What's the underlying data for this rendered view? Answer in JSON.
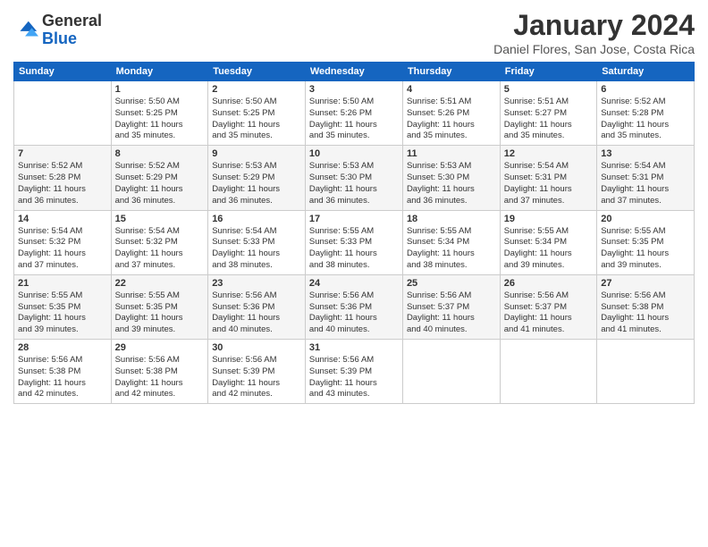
{
  "header": {
    "logo_line1": "General",
    "logo_line2": "Blue",
    "month_title": "January 2024",
    "subtitle": "Daniel Flores, San Jose, Costa Rica"
  },
  "days_of_week": [
    "Sunday",
    "Monday",
    "Tuesday",
    "Wednesday",
    "Thursday",
    "Friday",
    "Saturday"
  ],
  "weeks": [
    [
      {
        "day": "",
        "info": ""
      },
      {
        "day": "1",
        "info": "Sunrise: 5:50 AM\nSunset: 5:25 PM\nDaylight: 11 hours\nand 35 minutes."
      },
      {
        "day": "2",
        "info": "Sunrise: 5:50 AM\nSunset: 5:25 PM\nDaylight: 11 hours\nand 35 minutes."
      },
      {
        "day": "3",
        "info": "Sunrise: 5:50 AM\nSunset: 5:26 PM\nDaylight: 11 hours\nand 35 minutes."
      },
      {
        "day": "4",
        "info": "Sunrise: 5:51 AM\nSunset: 5:26 PM\nDaylight: 11 hours\nand 35 minutes."
      },
      {
        "day": "5",
        "info": "Sunrise: 5:51 AM\nSunset: 5:27 PM\nDaylight: 11 hours\nand 35 minutes."
      },
      {
        "day": "6",
        "info": "Sunrise: 5:52 AM\nSunset: 5:28 PM\nDaylight: 11 hours\nand 35 minutes."
      }
    ],
    [
      {
        "day": "7",
        "info": "Sunrise: 5:52 AM\nSunset: 5:28 PM\nDaylight: 11 hours\nand 36 minutes."
      },
      {
        "day": "8",
        "info": "Sunrise: 5:52 AM\nSunset: 5:29 PM\nDaylight: 11 hours\nand 36 minutes."
      },
      {
        "day": "9",
        "info": "Sunrise: 5:53 AM\nSunset: 5:29 PM\nDaylight: 11 hours\nand 36 minutes."
      },
      {
        "day": "10",
        "info": "Sunrise: 5:53 AM\nSunset: 5:30 PM\nDaylight: 11 hours\nand 36 minutes."
      },
      {
        "day": "11",
        "info": "Sunrise: 5:53 AM\nSunset: 5:30 PM\nDaylight: 11 hours\nand 36 minutes."
      },
      {
        "day": "12",
        "info": "Sunrise: 5:54 AM\nSunset: 5:31 PM\nDaylight: 11 hours\nand 37 minutes."
      },
      {
        "day": "13",
        "info": "Sunrise: 5:54 AM\nSunset: 5:31 PM\nDaylight: 11 hours\nand 37 minutes."
      }
    ],
    [
      {
        "day": "14",
        "info": "Sunrise: 5:54 AM\nSunset: 5:32 PM\nDaylight: 11 hours\nand 37 minutes."
      },
      {
        "day": "15",
        "info": "Sunrise: 5:54 AM\nSunset: 5:32 PM\nDaylight: 11 hours\nand 37 minutes."
      },
      {
        "day": "16",
        "info": "Sunrise: 5:54 AM\nSunset: 5:33 PM\nDaylight: 11 hours\nand 38 minutes."
      },
      {
        "day": "17",
        "info": "Sunrise: 5:55 AM\nSunset: 5:33 PM\nDaylight: 11 hours\nand 38 minutes."
      },
      {
        "day": "18",
        "info": "Sunrise: 5:55 AM\nSunset: 5:34 PM\nDaylight: 11 hours\nand 38 minutes."
      },
      {
        "day": "19",
        "info": "Sunrise: 5:55 AM\nSunset: 5:34 PM\nDaylight: 11 hours\nand 39 minutes."
      },
      {
        "day": "20",
        "info": "Sunrise: 5:55 AM\nSunset: 5:35 PM\nDaylight: 11 hours\nand 39 minutes."
      }
    ],
    [
      {
        "day": "21",
        "info": "Sunrise: 5:55 AM\nSunset: 5:35 PM\nDaylight: 11 hours\nand 39 minutes."
      },
      {
        "day": "22",
        "info": "Sunrise: 5:55 AM\nSunset: 5:35 PM\nDaylight: 11 hours\nand 39 minutes."
      },
      {
        "day": "23",
        "info": "Sunrise: 5:56 AM\nSunset: 5:36 PM\nDaylight: 11 hours\nand 40 minutes."
      },
      {
        "day": "24",
        "info": "Sunrise: 5:56 AM\nSunset: 5:36 PM\nDaylight: 11 hours\nand 40 minutes."
      },
      {
        "day": "25",
        "info": "Sunrise: 5:56 AM\nSunset: 5:37 PM\nDaylight: 11 hours\nand 40 minutes."
      },
      {
        "day": "26",
        "info": "Sunrise: 5:56 AM\nSunset: 5:37 PM\nDaylight: 11 hours\nand 41 minutes."
      },
      {
        "day": "27",
        "info": "Sunrise: 5:56 AM\nSunset: 5:38 PM\nDaylight: 11 hours\nand 41 minutes."
      }
    ],
    [
      {
        "day": "28",
        "info": "Sunrise: 5:56 AM\nSunset: 5:38 PM\nDaylight: 11 hours\nand 42 minutes."
      },
      {
        "day": "29",
        "info": "Sunrise: 5:56 AM\nSunset: 5:38 PM\nDaylight: 11 hours\nand 42 minutes."
      },
      {
        "day": "30",
        "info": "Sunrise: 5:56 AM\nSunset: 5:39 PM\nDaylight: 11 hours\nand 42 minutes."
      },
      {
        "day": "31",
        "info": "Sunrise: 5:56 AM\nSunset: 5:39 PM\nDaylight: 11 hours\nand 43 minutes."
      },
      {
        "day": "",
        "info": ""
      },
      {
        "day": "",
        "info": ""
      },
      {
        "day": "",
        "info": ""
      }
    ]
  ]
}
